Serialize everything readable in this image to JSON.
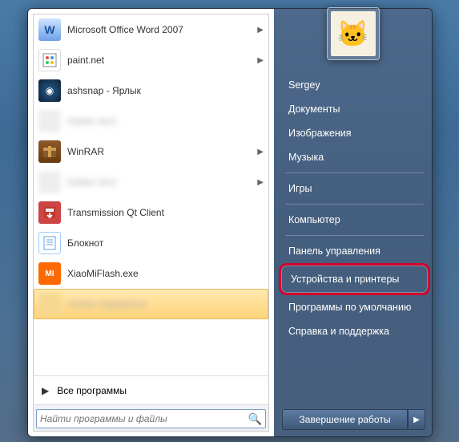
{
  "programs": [
    {
      "label": "Microsoft Office Word 2007",
      "has_submenu": true,
      "icon": "W"
    },
    {
      "label": "paint.net",
      "has_submenu": true,
      "icon": ""
    },
    {
      "label": "ashsnap - Ярлык",
      "has_submenu": false,
      "icon": "◉"
    },
    {
      "label": "hidden item",
      "has_submenu": false,
      "icon": "",
      "blurred": true
    },
    {
      "label": "WinRAR",
      "has_submenu": true,
      "icon": ""
    },
    {
      "label": "hidden item",
      "has_submenu": true,
      "icon": "",
      "blurred": true
    },
    {
      "label": "Transmission Qt Client",
      "has_submenu": false,
      "icon": "⬇"
    },
    {
      "label": "Блокнот",
      "has_submenu": false,
      "icon": ""
    },
    {
      "label": "XiaoMiFlash.exe",
      "has_submenu": false,
      "icon": "MI"
    },
    {
      "label": "hidden highlighted",
      "has_submenu": false,
      "icon": "",
      "blurred": true,
      "highlighted": true
    }
  ],
  "all_programs_label": "Все программы",
  "search": {
    "placeholder": "Найти программы и файлы"
  },
  "right_menu": {
    "user": "Sergey",
    "items_group1": [
      "Документы",
      "Изображения",
      "Музыка"
    ],
    "items_group2": [
      "Игры"
    ],
    "items_group3": [
      "Компьютер"
    ],
    "items_group4": [
      "Панель управления",
      "Устройства и принтеры",
      "Программы по умолчанию",
      "Справка и поддержка"
    ],
    "highlighted_index": 1
  },
  "shutdown_label": "Завершение работы",
  "avatar_emoji": "🐱"
}
